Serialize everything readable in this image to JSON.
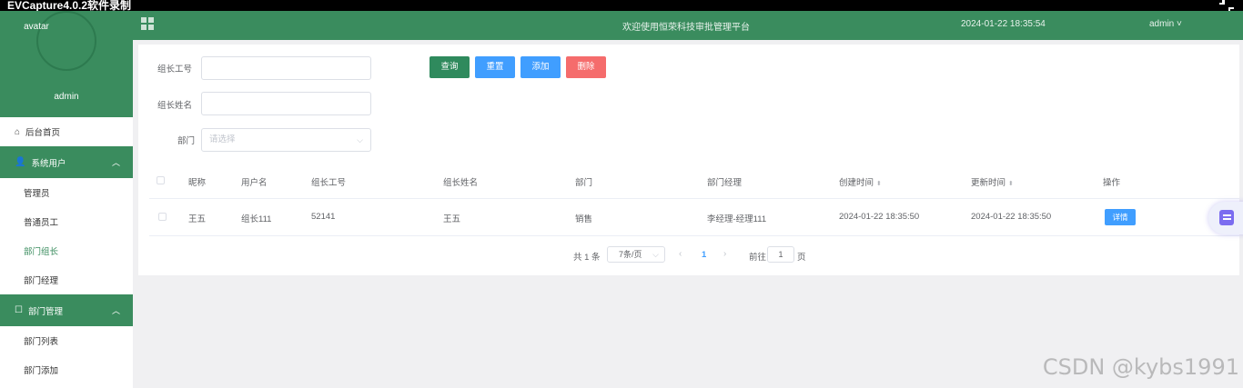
{
  "recorder": {
    "title": "EVCapture4.0.2软件录制"
  },
  "sidebar": {
    "avatar_text": "avatar",
    "username": "admin",
    "home_label": "后台首页",
    "group1": {
      "label": "系统用户",
      "items": [
        "管理员",
        "普通员工",
        "部门组长",
        "部门经理"
      ]
    },
    "group2": {
      "label": "部门管理",
      "items": [
        "部门列表",
        "部门添加"
      ]
    },
    "active_item": "部门组长",
    "accent_color": "#3a8c5e"
  },
  "header": {
    "welcome": "欢迎使用恒荣科技审批管理平台",
    "datetime": "2024-01-22 18:35:54",
    "user_menu": "admin"
  },
  "search": {
    "leader_id_label": "组长工号",
    "leader_name_label": "组长姓名",
    "dept_label": "部门",
    "dept_placeholder": "请选择",
    "leader_id_value": "",
    "leader_name_value": ""
  },
  "buttons": {
    "query": "查询",
    "reset": "重置",
    "add": "添加",
    "delete": "删除"
  },
  "table": {
    "columns": [
      "昵称",
      "用户名",
      "组长工号",
      "组长姓名",
      "部门",
      "部门经理",
      "创建时间",
      "更新时间",
      "操作"
    ],
    "rows": [
      {
        "nickname": "王五",
        "username": "组长111",
        "leader_id": "52141",
        "leader_name": "王五",
        "dept": "销售",
        "manager": "李经理-经理111",
        "created": "2024-01-22 18:35:50",
        "updated": "2024-01-22 18:35:50",
        "action": "详情"
      }
    ]
  },
  "pagination": {
    "total": "共 1 条",
    "page_size": "7条/页",
    "current": "1",
    "goto_label": "前往",
    "goto_value": "1",
    "page_label": "页"
  },
  "watermark": "CSDN @kybs1991"
}
